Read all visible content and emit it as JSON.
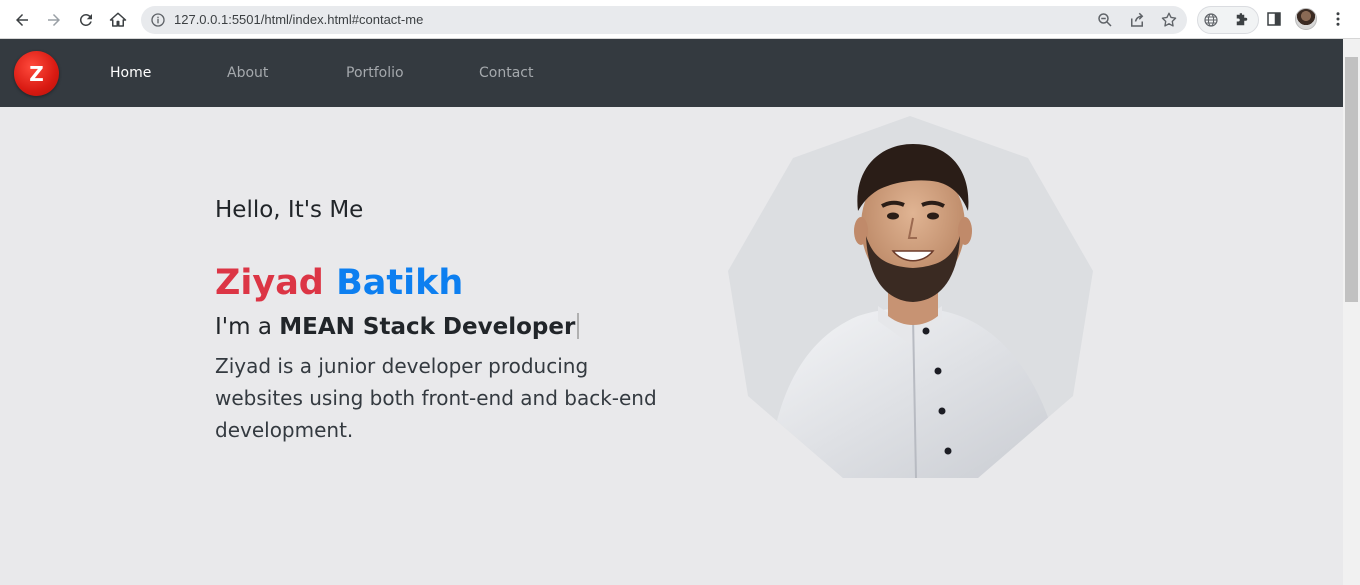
{
  "browser": {
    "url": "127.0.0.1:5501/html/index.html#contact-me"
  },
  "site": {
    "logo_letter": "Z",
    "nav": [
      {
        "label": "Home",
        "active": true
      },
      {
        "label": "About",
        "active": false
      },
      {
        "label": "Portfolio",
        "active": false
      },
      {
        "label": "Contact",
        "active": false
      }
    ]
  },
  "hero": {
    "greeting": "Hello, It's Me",
    "first_name": "Ziyad",
    "last_name": "Batikh",
    "role_prefix": "I'm a ",
    "role_title": "MEAN Stack Developer",
    "description": "Ziyad is a junior developer producing websites using both front-end and back-end development."
  },
  "colors": {
    "navbar": "#343a40",
    "page_bg": "#e9e9eb",
    "first_name": "#dc3545",
    "last_name": "#0d7ff0",
    "logo": "#e3241a"
  },
  "icons": [
    "back-icon",
    "forward-icon",
    "reload-icon",
    "home-icon",
    "info-icon",
    "zoom-icon",
    "share-icon",
    "star-icon",
    "globe-icon",
    "puzzle-icon",
    "sidepanel-icon",
    "profile-avatar",
    "kebab-menu-icon"
  ]
}
